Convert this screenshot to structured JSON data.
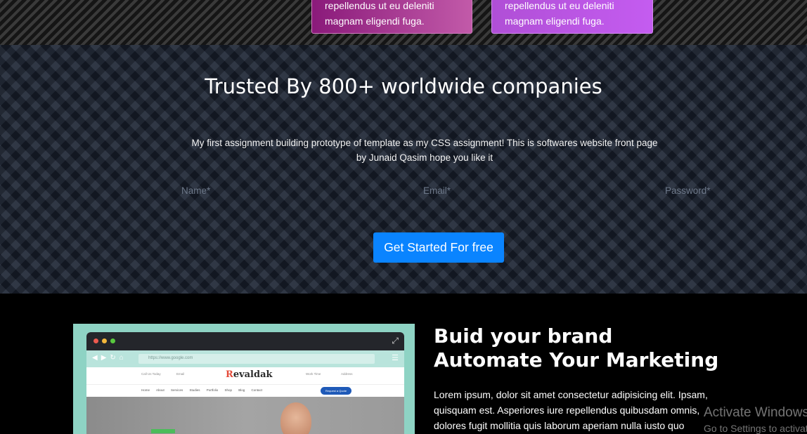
{
  "cards": [
    {
      "line1": "repellendus ut eu deleniti",
      "line2": "magnam eligendi fuga."
    },
    {
      "line1": "repellendus ut eu deleniti",
      "line2": "magnam eligendi fuga."
    }
  ],
  "trusted": {
    "title": "Trusted By 800+ worldwide companies",
    "description_line1": "My first assignment building prototype of template as my CSS assignment! This is softwares website front page",
    "description_line2": "by Junaid Qasim hope you like it",
    "name_placeholder": "Name*",
    "email_placeholder": "Email*",
    "password_placeholder": "Password*",
    "cta_label": "Get Started For free",
    "cta_color": "#0a84ff"
  },
  "mockup": {
    "url": "https://www.google.com",
    "logo_initial": "R",
    "logo_text": "evaldak",
    "info": [
      "Call Us Today",
      "Email",
      "Work Time",
      "Address"
    ],
    "nav": "Home About Services Studies Portfolio Shop Blog Contact",
    "quote_button": "Request a Quote"
  },
  "brand": {
    "heading_line1": "Buid your brand",
    "heading_line2": "Automate Your Marketing",
    "text_line1": "Lorem ipsum, dolor sit amet consectetur adipisicing elit. Ipsam,",
    "text_line2": "quisquam est. Asperiores iure repellendus quibusdam omnis,",
    "text_line3": "dolores fugit mollitia quis laborum aperiam nulla iusto quo"
  },
  "watermark": {
    "title": "Activate Windows",
    "subtitle": "Go to Settings to activate Windows."
  }
}
